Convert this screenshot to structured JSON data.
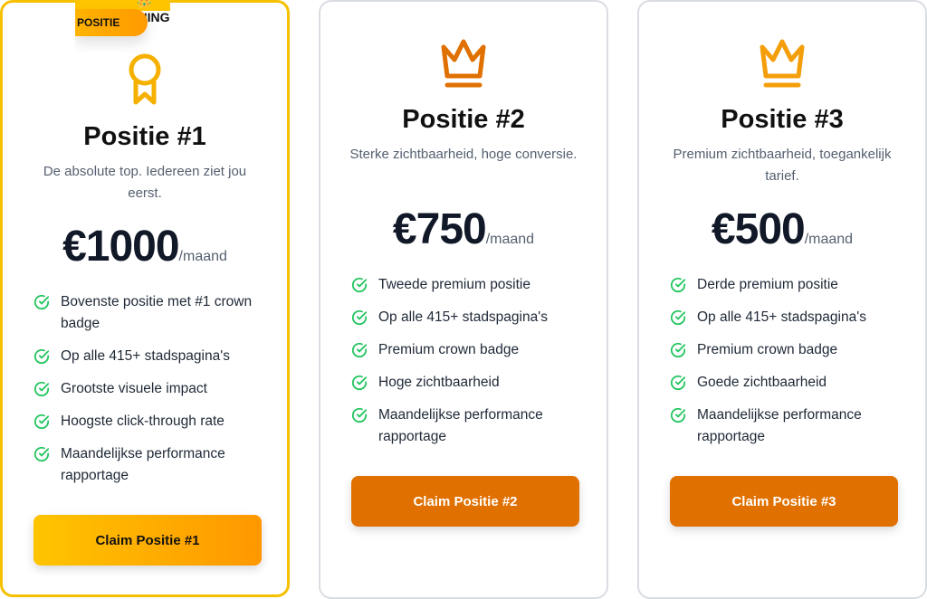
{
  "accent": "#e07000",
  "gold": "#f5c000",
  "check_color": "#22c55e",
  "badge": {
    "line1": "👑 KONING",
    "line2": "POSITIE"
  },
  "plans": [
    {
      "icon": "award-icon",
      "title": "Positie #1",
      "subtitle": "De absolute top. Iedereen ziet jou eerst.",
      "price": "€1000",
      "period": "/maand",
      "features": [
        "Bovenste positie met #1 crown badge",
        "Op alle 415+ stadspagina's",
        "Grootste visuele impact",
        "Hoogste click-through rate",
        "Maandelijkse performance rapportage"
      ],
      "button": "Claim Positie #1"
    },
    {
      "icon": "crown-icon",
      "title": "Positie #2",
      "subtitle": "Sterke zichtbaarheid, hoge conversie.",
      "price": "€750",
      "period": "/maand",
      "features": [
        "Tweede premium positie",
        "Op alle 415+ stadspagina's",
        "Premium crown badge",
        "Hoge zichtbaarheid",
        "Maandelijkse performance rapportage"
      ],
      "button": "Claim Positie #2"
    },
    {
      "icon": "crown-icon",
      "title": "Positie #3",
      "subtitle": "Premium zichtbaarheid, toegankelijk tarief.",
      "price": "€500",
      "period": "/maand",
      "features": [
        "Derde premium positie",
        "Op alle 415+ stadspagina's",
        "Premium crown badge",
        "Goede zichtbaarheid",
        "Maandelijkse performance rapportage"
      ],
      "button": "Claim Positie #3"
    }
  ]
}
